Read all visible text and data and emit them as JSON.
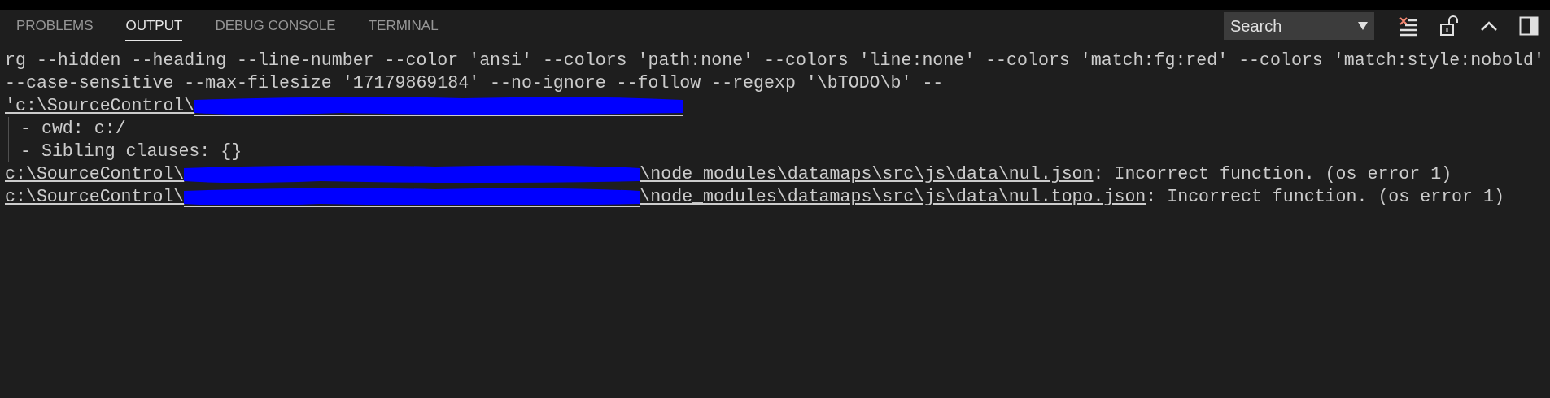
{
  "tabs": [
    {
      "label": "PROBLEMS",
      "selected": false
    },
    {
      "label": "OUTPUT",
      "selected": true
    },
    {
      "label": "DEBUG CONSOLE",
      "selected": false
    },
    {
      "label": "TERMINAL",
      "selected": false
    }
  ],
  "channel_select": {
    "value": "Search"
  },
  "output_lines": [
    {
      "kind": "text",
      "text": "rg --hidden --heading --line-number --color 'ansi' --colors 'path:none' --colors 'line:none' --colors 'match:fg:red' --colors 'match:style:nobold'"
    },
    {
      "kind": "text",
      "text": "--case-sensitive --max-filesize '17179869184' --no-ignore --follow --regexp '\\bTODO\\b' --"
    },
    {
      "kind": "path",
      "before": "'c:\\SourceControl\\",
      "redacted": true
    },
    {
      "kind": "detail",
      "text": "- cwd: c:/"
    },
    {
      "kind": "detail",
      "text": "- Sibling clauses: {}"
    },
    {
      "kind": "path",
      "before": "c:\\SourceControl\\",
      "redacted": true,
      "after": "\\node_modules\\datamaps\\src\\js\\data\\nul.json",
      "message": ": Incorrect function. (os error 1)"
    },
    {
      "kind": "path",
      "before": "c:\\SourceControl\\",
      "redacted": true,
      "after": "\\node_modules\\datamaps\\src\\js\\data\\nul.topo.json",
      "message": ": Incorrect function. (os error 1)"
    }
  ]
}
